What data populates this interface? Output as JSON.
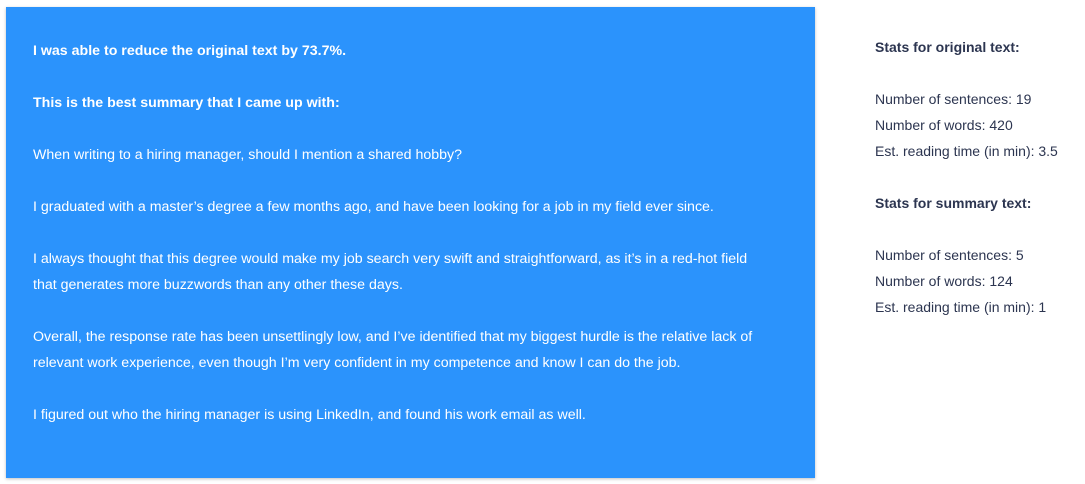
{
  "summary": {
    "reduction_line": "I was able to reduce the original text by 73.7%.",
    "best_summary_line": "This is the best summary that I came up with:",
    "paragraphs": [
      [
        "When writing to a hiring manager, should I mention a shared hobby?"
      ],
      [
        "I graduated with a master’s degree a few months ago, and have been looking for a job in my field ever since."
      ],
      [
        "I always thought that this degree would make my job search very swift and straightforward, as it’s in a red-hot field",
        "that generates more buzzwords than any other these days."
      ],
      [
        "Overall, the response rate has been unsettlingly low, and I’ve identified that my biggest hurdle is the relative lack of",
        "relevant work experience, even though I’m very confident in my competence and know I can do the job."
      ],
      [
        "I figured out who the hiring manager is using LinkedIn, and found his work email as well."
      ]
    ]
  },
  "stats": {
    "original": {
      "heading": "Stats for original text:",
      "sentences": "Number of sentences: 19",
      "words": "Number of words: 420",
      "reading_time": "Est. reading time (in min): 3.5"
    },
    "summary": {
      "heading": "Stats for summary text:",
      "sentences": "Number of sentences: 5",
      "words": "Number of words: 124",
      "reading_time": "Est. reading time (in min): 1"
    }
  },
  "colors": {
    "panel_background": "#2b93fc",
    "panel_text": "#ffffff",
    "stats_text": "#2c3550"
  }
}
